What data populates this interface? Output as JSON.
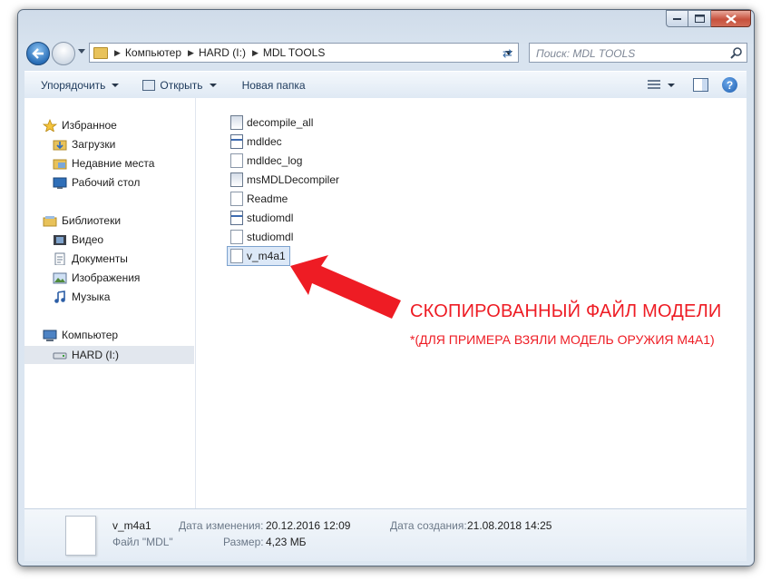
{
  "breadcrumb": [
    "Компьютер",
    "HARD (I:)",
    "MDL TOOLS"
  ],
  "search": {
    "placeholder": "Поиск: MDL TOOLS"
  },
  "toolbar": {
    "organize": "Упорядочить",
    "open": "Открыть",
    "new_folder": "Новая папка"
  },
  "sidebar": {
    "favorites": "Избранное",
    "downloads": "Загрузки",
    "recent": "Недавние места",
    "desktop": "Рабочий стол",
    "libraries": "Библиотеки",
    "video": "Видео",
    "documents": "Документы",
    "images": "Изображения",
    "music": "Музыка",
    "computer": "Компьютер",
    "drive": "HARD (I:)"
  },
  "files": [
    "decompile_all",
    "mdldec",
    "mdldec_log",
    "msMDLDecompiler",
    "Readme",
    "studiomdl",
    "studiomdl",
    "v_m4a1"
  ],
  "annotation": {
    "main": "СКОПИРОВАННЫЙ ФАЙЛ МОДЕЛИ",
    "sub": "*(ДЛЯ ПРИМЕРА ВЗЯЛИ МОДЕЛЬ ОРУЖИЯ M4A1)"
  },
  "details": {
    "name": "v_m4a1",
    "type": "Файл \"MDL\"",
    "modified_label": "Дата изменения:",
    "modified": "20.12.2016 12:09",
    "size_label": "Размер:",
    "size": "4,23 МБ",
    "created_label": "Дата создания:",
    "created": "21.08.2018 14:25"
  },
  "colors": {
    "annotation": "#ee1c24",
    "selection": "#dce8f7"
  }
}
